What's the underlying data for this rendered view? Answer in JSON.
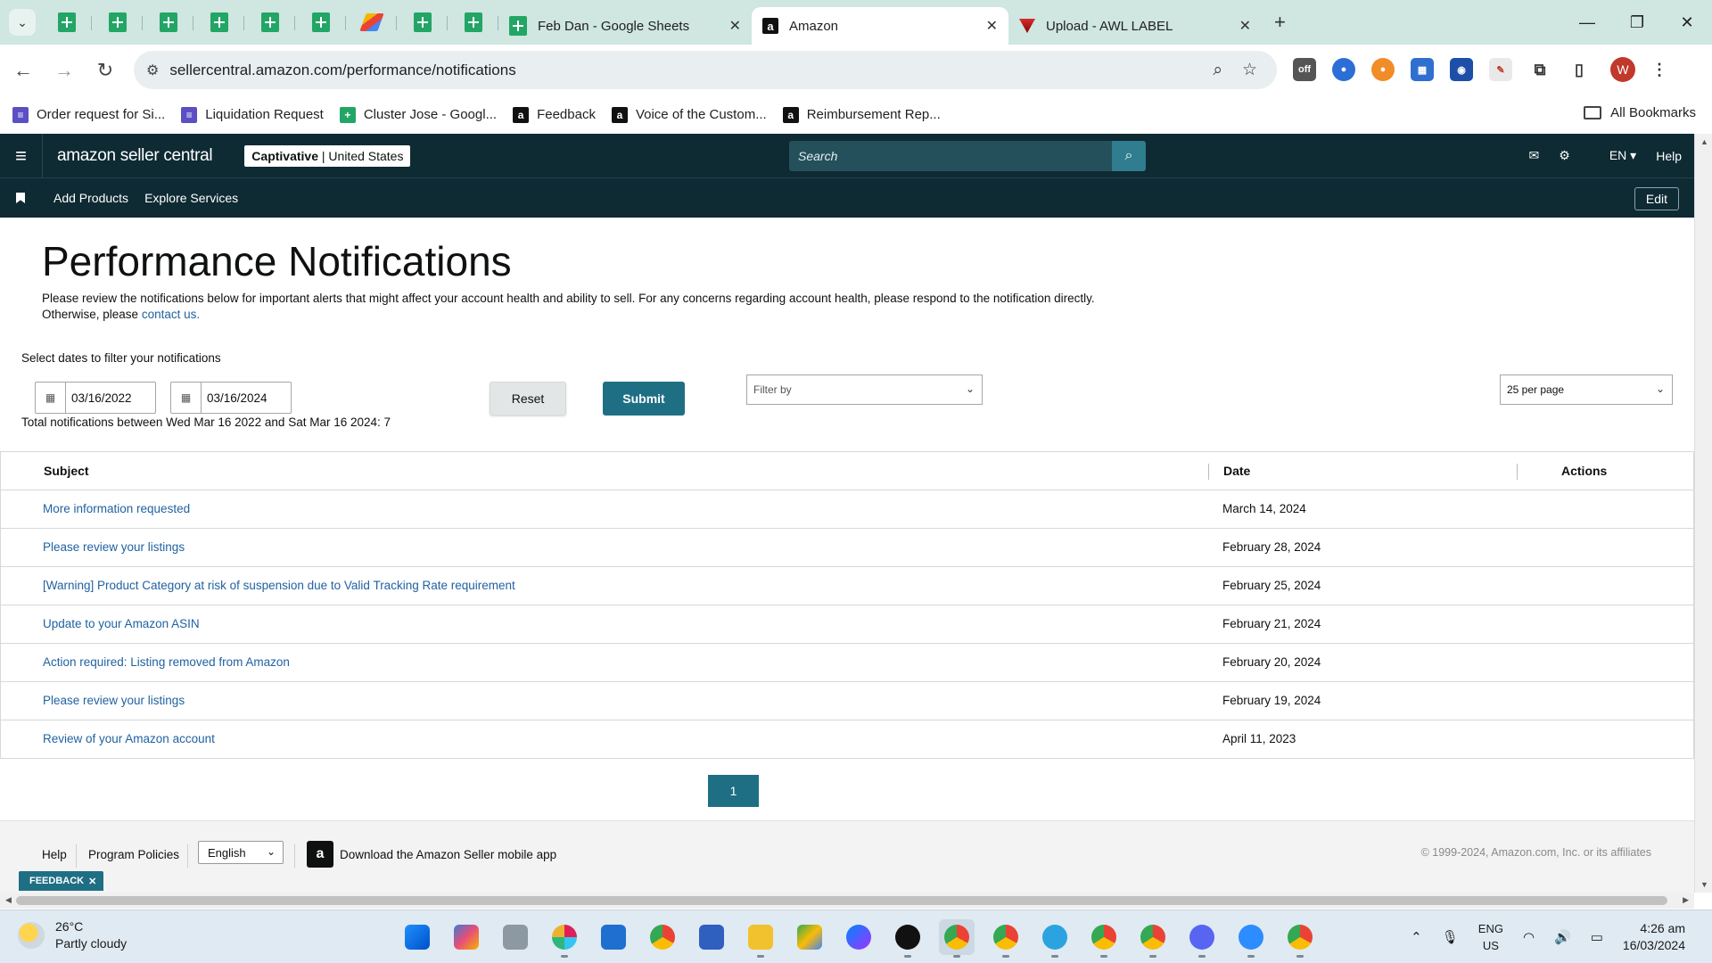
{
  "browser": {
    "tabs": [
      {
        "title": "Feb Dan - Google Sheets",
        "icon": "sheets-icon",
        "active": false
      },
      {
        "title": "Amazon",
        "icon": "amazon-icon",
        "active": true
      },
      {
        "title": "Upload - AWL LABEL",
        "icon": "awl-icon",
        "active": false
      }
    ],
    "url": "sellercentral.amazon.com/performance/notifications",
    "profile_initial": "W",
    "bookmarks": [
      {
        "label": "Order request for Si...",
        "color": "#5b4fc4"
      },
      {
        "label": "Liquidation Request",
        "color": "#5b4fc4"
      },
      {
        "label": "Cluster Jose - Googl...",
        "color": "#23a566"
      },
      {
        "label": "Feedback",
        "color": "#111111"
      },
      {
        "label": "Voice of the Custom...",
        "color": "#111111"
      },
      {
        "label": "Reimbursement Rep...",
        "color": "#111111"
      }
    ],
    "all_bookmarks": "All Bookmarks"
  },
  "header": {
    "logo": "amazon seller central",
    "store": "Captivative",
    "marketplace": "United States",
    "search_placeholder": "Search",
    "language": "EN",
    "help": "Help"
  },
  "subnav": {
    "items": [
      "Add Products",
      "Explore Services"
    ],
    "edit": "Edit"
  },
  "page": {
    "title": "Performance Notifications",
    "intro": "Please review the notifications below for important alerts that might affect your account health and ability to sell. For any concerns regarding account health, please respond to the notification directly. Otherwise, please",
    "contact_link": "contact us.",
    "filter_label": "Select dates to filter your notifications",
    "start_date": "03/16/2022",
    "end_date": "03/16/2024",
    "reset": "Reset",
    "submit": "Submit",
    "filter_by_placeholder": "Filter by",
    "per_page": "25 per page",
    "total": "Total notifications between Wed Mar 16 2022 and Sat Mar 16 2024: 7"
  },
  "table": {
    "headers": {
      "subject": "Subject",
      "date": "Date",
      "actions": "Actions"
    },
    "rows": [
      {
        "subject": "More information requested",
        "date": "March 14, 2024"
      },
      {
        "subject": "Please review your listings",
        "date": "February 28, 2024"
      },
      {
        "subject": "[Warning] Product Category at risk of suspension due to Valid Tracking Rate requirement",
        "date": "February 25, 2024"
      },
      {
        "subject": "Update to your Amazon ASIN",
        "date": "February 21, 2024"
      },
      {
        "subject": "Action required: Listing removed from Amazon",
        "date": "February 20, 2024"
      },
      {
        "subject": "Please review your listings",
        "date": "February 19, 2024"
      },
      {
        "subject": "Review of your Amazon account",
        "date": "April 11, 2023"
      }
    ]
  },
  "pagination": {
    "current": "1"
  },
  "footer": {
    "help": "Help",
    "policies": "Program Policies",
    "language": "English",
    "app_text": "Download the Amazon Seller mobile app",
    "copyright": "© 1999-2024, Amazon.com, Inc. or its affiliates"
  },
  "feedback": "FEEDBACK",
  "taskbar": {
    "temperature": "26°C",
    "weather": "Partly cloudy",
    "lang_line1": "ENG",
    "lang_line2": "US",
    "time": "4:26 am",
    "date": "16/03/2024"
  },
  "colors": {
    "header_bg": "#0e2a33",
    "accent": "#1f6f84",
    "link": "#2162a1"
  }
}
